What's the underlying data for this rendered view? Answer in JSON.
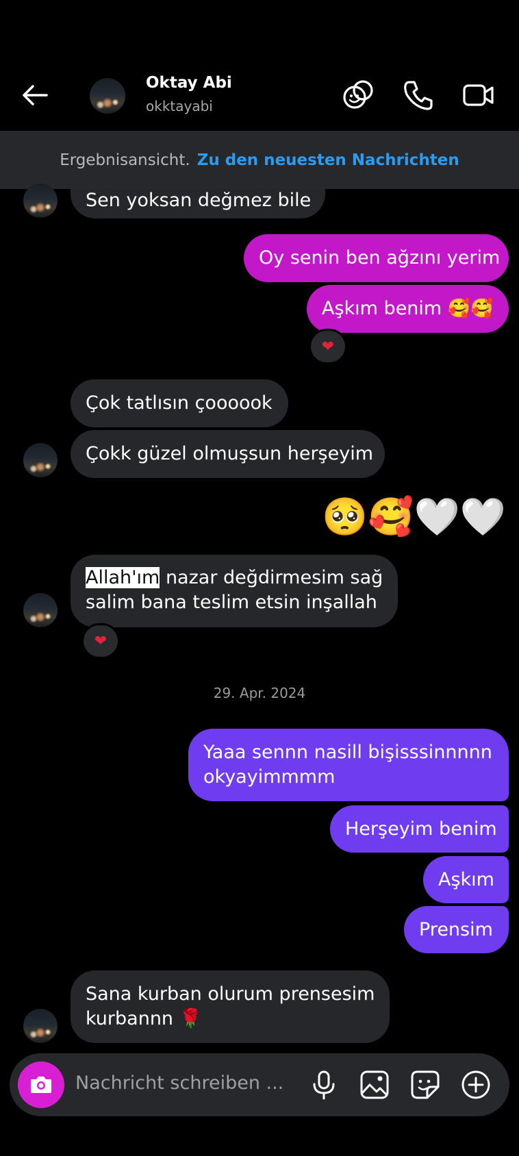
{
  "header": {
    "name": "Oktay Abi",
    "username": "okktayabi",
    "icons": [
      "back-arrow-icon",
      "chat-theme-icon",
      "phone-icon",
      "video-icon"
    ]
  },
  "banner": {
    "text": "Ergebnisansicht.",
    "link": "Zu den neuesten Nachrichten"
  },
  "messages": {
    "m1": "Sen yoksan değmez bile",
    "m2": "Oy senin ben ağzını yerim",
    "m3": "Aşkım benim 🥰🥰",
    "m3_reaction": "❤",
    "m4": "Çok tatlısın çoooook",
    "m5": "Çokk güzel olmuşsun herşeyim",
    "m6": "🥺🥰🤍🤍",
    "m7_highlight": "Allah'ım",
    "m7_rest": " nazar değdirmesim sağ",
    "m7_line2": "salim bana teslim etsin inşallah",
    "m7_reaction": "❤",
    "date": "29. Apr. 2024",
    "m8_line1": "Yaaa sennn nasill bişisssinnnnn",
    "m8_line2": "okyayimmmm",
    "m9": "Herşeyim benim",
    "m10": "Aşkım",
    "m11": "Prensim",
    "m12_line1": "Sana kurban olurum prensesim",
    "m12_line2": "kurbannn 🌹"
  },
  "composer": {
    "placeholder": "Nachricht schreiben ...",
    "icons": [
      "camera-icon",
      "microphone-icon",
      "gallery-icon",
      "sticker-icon",
      "plus-icon"
    ]
  },
  "colors": {
    "pink_bubble": "#c218c8",
    "purple_bubble": "#6f3cf0",
    "incoming_bubble": "#26272a",
    "link_blue": "#2d9bf0",
    "camera_button": "#d91fd4"
  }
}
